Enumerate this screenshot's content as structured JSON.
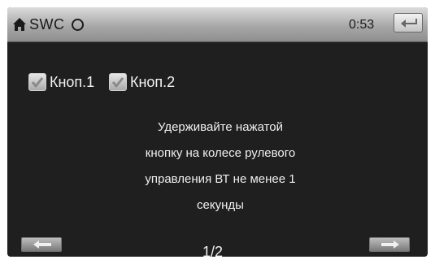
{
  "header": {
    "title": "SWC",
    "time": "0:53"
  },
  "buttons": [
    {
      "label": "Кноп.1",
      "checked": true
    },
    {
      "label": "Кноп.2",
      "checked": true
    }
  ],
  "instruction": {
    "lines": [
      "Удерживайте нажатой",
      "кнопку на колесе рулевого",
      "управления ВТ не менее 1",
      "секунды"
    ]
  },
  "pager": {
    "text": "1/2"
  },
  "icons": {
    "home": "home-icon",
    "status": "circle-icon",
    "back": "return-arrow-icon",
    "prev": "arrow-left-icon",
    "next": "arrow-right-icon",
    "check": "checkmark-icon"
  },
  "colors": {
    "screen_bg": "#1f1f1f",
    "header_bg": "#a8a8a8",
    "text": "#f0f0f0"
  }
}
